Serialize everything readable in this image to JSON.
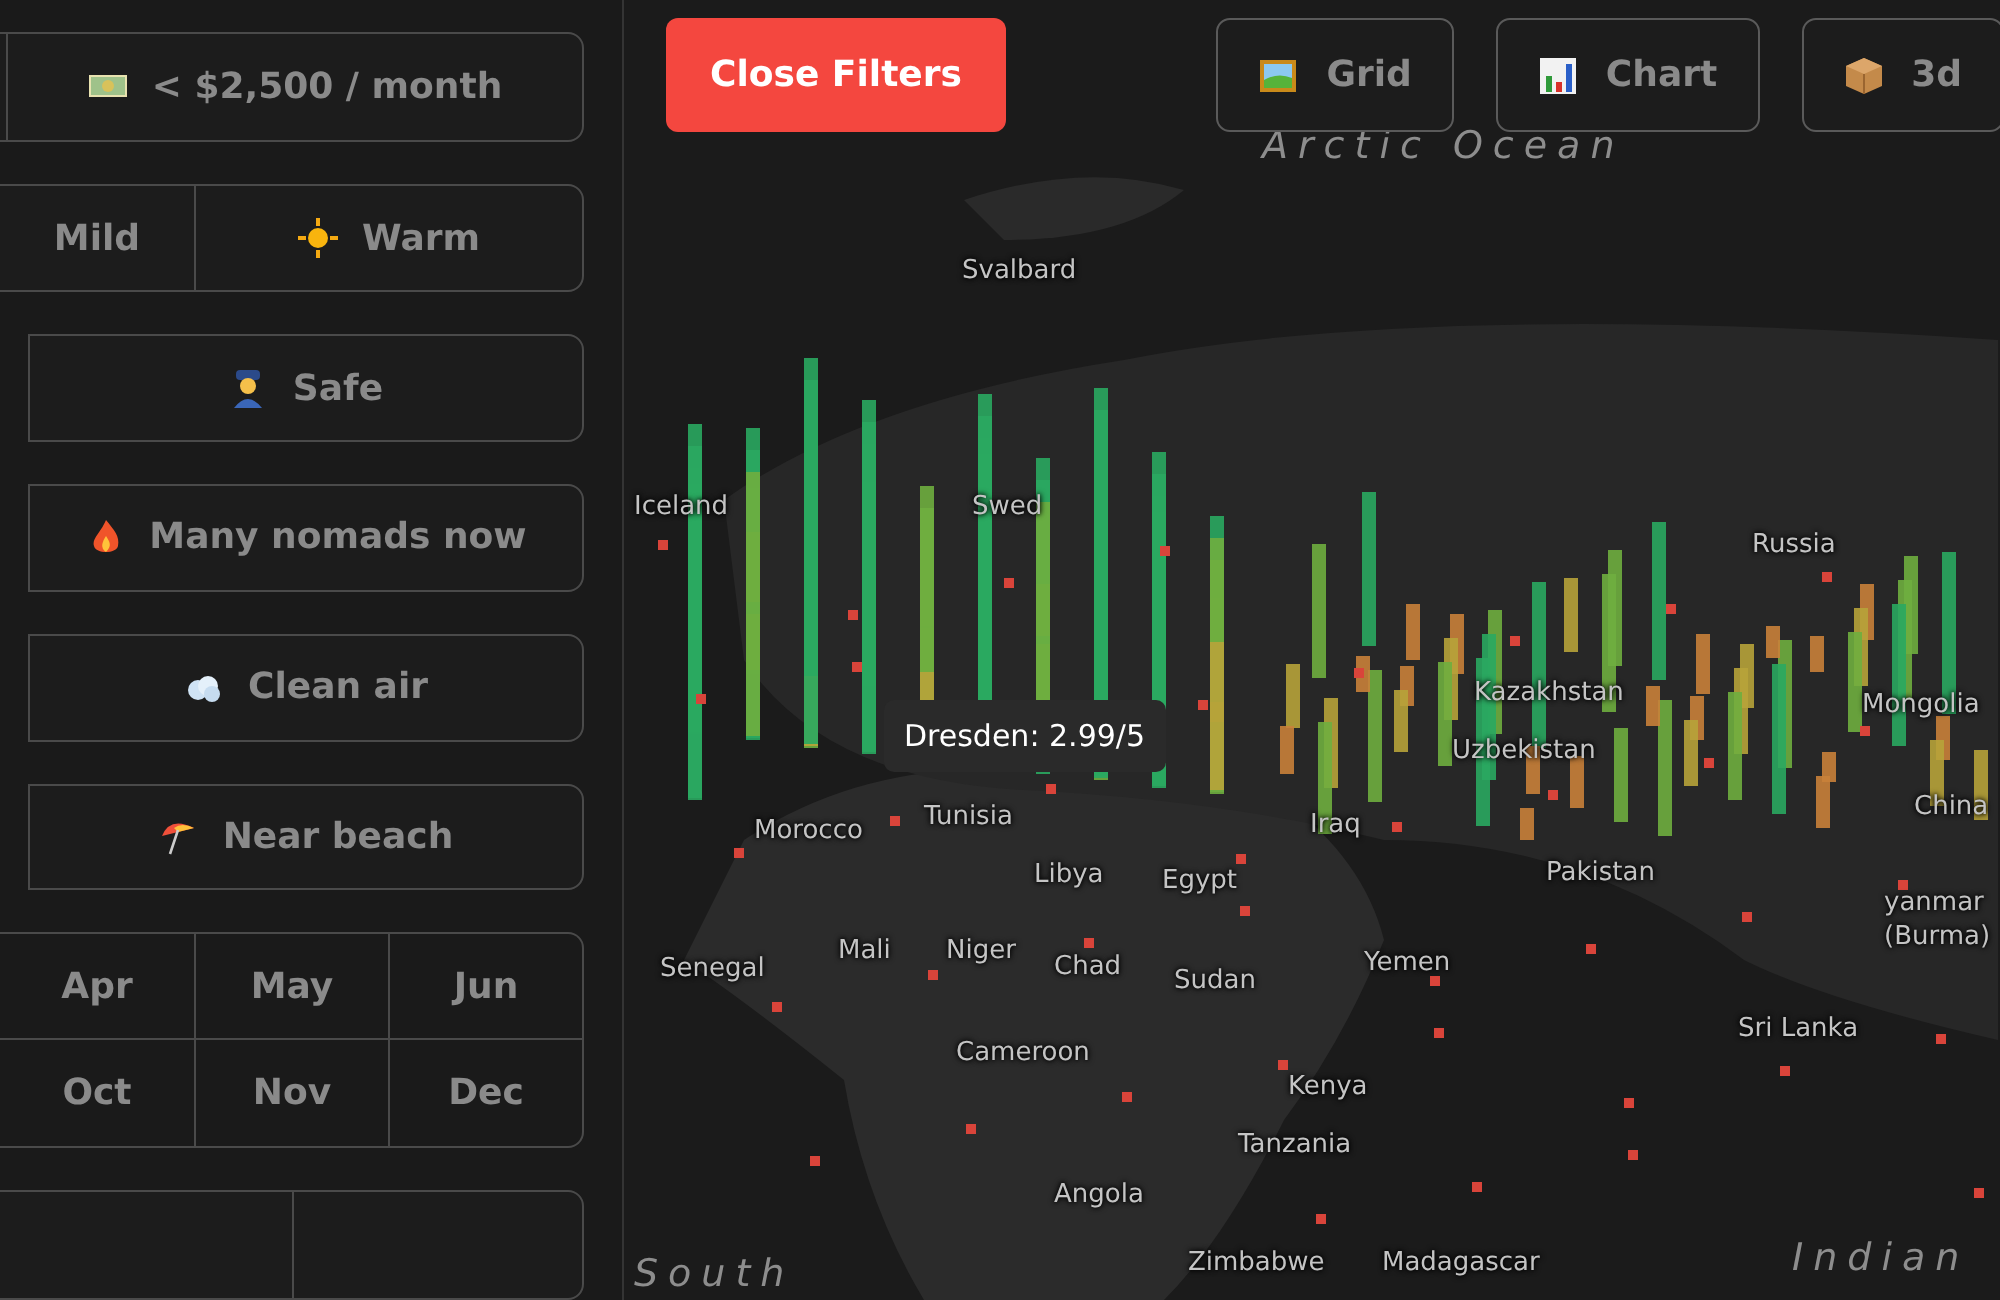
{
  "filters": [
    {
      "kind": "single",
      "items": [
        {
          "kind": "blank"
        },
        {
          "label": "< $2,500 / month",
          "kind": "money"
        }
      ]
    },
    {
      "kind": "split",
      "items": [
        {
          "label": "Mild",
          "kind": "none"
        },
        {
          "label": "Warm",
          "kind": "sun"
        }
      ]
    },
    {
      "kind": "wide",
      "items": [
        {
          "label": "Safe",
          "kind": "police"
        }
      ]
    },
    {
      "kind": "wide",
      "items": [
        {
          "label": "Many nomads now",
          "kind": "fire"
        }
      ]
    },
    {
      "kind": "wide",
      "items": [
        {
          "label": "Clean air",
          "kind": "cloud"
        }
      ]
    },
    {
      "kind": "wide",
      "items": [
        {
          "label": "Near beach",
          "kind": "umbrella"
        }
      ]
    }
  ],
  "months": [
    "Apr",
    "May",
    "Jun",
    "Oct",
    "Nov",
    "Dec"
  ],
  "close_button": "Close Filters",
  "view_buttons": [
    {
      "label": "Grid",
      "kind": "picture"
    },
    {
      "label": "Chart",
      "kind": "chart"
    },
    {
      "label": "3d",
      "kind": "box"
    }
  ],
  "map": {
    "ocean_labels": [
      "Arctic Ocean",
      "South",
      "Indian"
    ],
    "labels": [
      "Svalbard",
      "Iceland",
      "Swed",
      "Russia",
      "Kazakhstan",
      "Mongolia",
      "Uzbekistan",
      "Morocco",
      "Tunisia",
      "Iraq",
      "China",
      "Libya",
      "Egypt",
      "Pakistan",
      "yanmar",
      "(Burma)",
      "Senegal",
      "Mali",
      "Niger",
      "Chad",
      "Sudan",
      "Yemen",
      "Cameroon",
      "Sri Lanka",
      "Kenya",
      "Tanzania",
      "Angola",
      "Zimbabwe",
      "Madagascar"
    ],
    "tooltip": "Dresden: 2.99/5"
  }
}
